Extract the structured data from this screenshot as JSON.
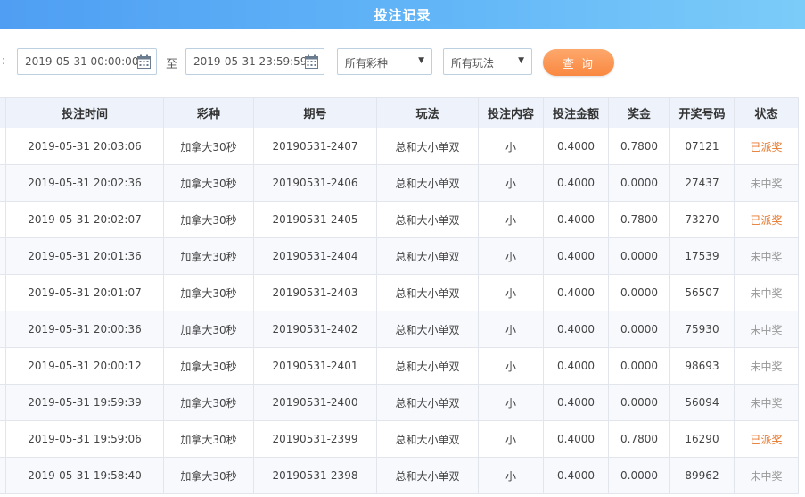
{
  "header": {
    "title": "投注记录"
  },
  "filters": {
    "colon": ":",
    "start_date": "2019-05-31 00:00:00",
    "to_label": "至",
    "end_date": "2019-05-31 23:59:59",
    "lottery_select": "所有彩种",
    "play_select": "所有玩法",
    "query_label": "查 询"
  },
  "table": {
    "columns": [
      "投注时间",
      "彩种",
      "期号",
      "玩法",
      "投注内容",
      "投注金额",
      "奖金",
      "开奖号码",
      "状态"
    ],
    "rows": [
      {
        "time": "2019-05-31 20:03:06",
        "lottery": "加拿大30秒",
        "issue": "20190531-2407",
        "play": "总和大小单双",
        "content": "小",
        "amount": "0.4000",
        "bonus": "0.7800",
        "numbers": "07121",
        "status": "已派奖",
        "won": true
      },
      {
        "time": "2019-05-31 20:02:36",
        "lottery": "加拿大30秒",
        "issue": "20190531-2406",
        "play": "总和大小单双",
        "content": "小",
        "amount": "0.4000",
        "bonus": "0.0000",
        "numbers": "27437",
        "status": "未中奖",
        "won": false
      },
      {
        "time": "2019-05-31 20:02:07",
        "lottery": "加拿大30秒",
        "issue": "20190531-2405",
        "play": "总和大小单双",
        "content": "小",
        "amount": "0.4000",
        "bonus": "0.7800",
        "numbers": "73270",
        "status": "已派奖",
        "won": true
      },
      {
        "time": "2019-05-31 20:01:36",
        "lottery": "加拿大30秒",
        "issue": "20190531-2404",
        "play": "总和大小单双",
        "content": "小",
        "amount": "0.4000",
        "bonus": "0.0000",
        "numbers": "17539",
        "status": "未中奖",
        "won": false
      },
      {
        "time": "2019-05-31 20:01:07",
        "lottery": "加拿大30秒",
        "issue": "20190531-2403",
        "play": "总和大小单双",
        "content": "小",
        "amount": "0.4000",
        "bonus": "0.0000",
        "numbers": "56507",
        "status": "未中奖",
        "won": false
      },
      {
        "time": "2019-05-31 20:00:36",
        "lottery": "加拿大30秒",
        "issue": "20190531-2402",
        "play": "总和大小单双",
        "content": "小",
        "amount": "0.4000",
        "bonus": "0.0000",
        "numbers": "75930",
        "status": "未中奖",
        "won": false
      },
      {
        "time": "2019-05-31 20:00:12",
        "lottery": "加拿大30秒",
        "issue": "20190531-2401",
        "play": "总和大小单双",
        "content": "小",
        "amount": "0.4000",
        "bonus": "0.0000",
        "numbers": "98693",
        "status": "未中奖",
        "won": false
      },
      {
        "time": "2019-05-31 19:59:39",
        "lottery": "加拿大30秒",
        "issue": "20190531-2400",
        "play": "总和大小单双",
        "content": "小",
        "amount": "0.4000",
        "bonus": "0.0000",
        "numbers": "56094",
        "status": "未中奖",
        "won": false
      },
      {
        "time": "2019-05-31 19:59:06",
        "lottery": "加拿大30秒",
        "issue": "20190531-2399",
        "play": "总和大小单双",
        "content": "小",
        "amount": "0.4000",
        "bonus": "0.7800",
        "numbers": "16290",
        "status": "已派奖",
        "won": true
      },
      {
        "time": "2019-05-31 19:58:40",
        "lottery": "加拿大30秒",
        "issue": "20190531-2398",
        "play": "总和大小单双",
        "content": "小",
        "amount": "0.4000",
        "bonus": "0.0000",
        "numbers": "89962",
        "status": "未中奖",
        "won": false
      }
    ]
  },
  "colors": {
    "won": "#e8762b",
    "lost": "#999999",
    "accent": "#f98841",
    "header_bg": "#4f9ef3"
  }
}
